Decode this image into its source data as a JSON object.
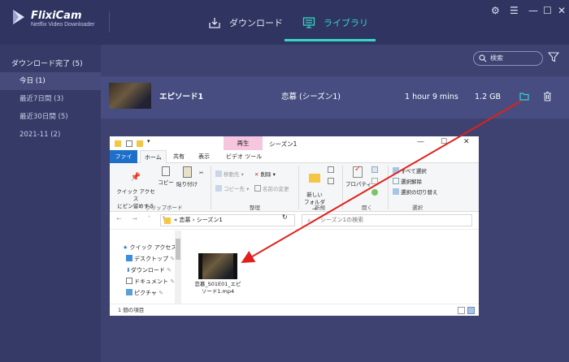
{
  "app": {
    "brand": "FlixiCam",
    "subtitle": "Netflix Video Downloader",
    "tabs": {
      "download": "ダウンロード",
      "library": "ライブラリ"
    }
  },
  "sidebar": {
    "header": "ダウンロード完了 (5)",
    "items": [
      {
        "label": "今日 (1)"
      },
      {
        "label": "最近7日間 (3)"
      },
      {
        "label": "最近30日間 (5)"
      },
      {
        "label": "2021-11 (2)"
      }
    ]
  },
  "toolbar": {
    "search_label": "検索"
  },
  "library_row": {
    "title": "エピソード1",
    "season": "恋慕 (シーズン1)",
    "duration": "1 hour 9 mins",
    "size": "1.2 GB"
  },
  "explorer": {
    "context_tab": "再生",
    "window_title": "シーズン1",
    "ribbon_tabs": {
      "file": "ファイル",
      "home": "ホーム",
      "share": "共有",
      "view": "表示",
      "video_tools": "ビデオ ツール"
    },
    "ribbon": {
      "pin_quick_access": "クイック アクセス\nにピン留めする",
      "copy": "コピー",
      "paste": "貼り付け",
      "move_to": "移動先",
      "copy_to": "コピー先",
      "delete": "削除",
      "rename": "名前の変更",
      "new_folder": "新しい\nフォルダー",
      "properties": "プロパティ",
      "select_all": "すべて選択",
      "select_none": "選択解除",
      "invert_selection": "選択の切り替え",
      "group_clipboard": "クリップボード",
      "group_organize": "整理",
      "group_new": "新規",
      "group_open": "開く",
      "group_select": "選択"
    },
    "address": {
      "path": "« 恋慕 › シーズン1",
      "search_placeholder": "シーズン1の検索"
    },
    "nav": {
      "quick_access": "クイック アクセス",
      "desktop": "デスクトップ",
      "downloads": "ダウンロード",
      "documents": "ドキュメント",
      "pictures": "ピクチャ"
    },
    "file": {
      "name": "恋慕_S01E01_エピソード1.mp4"
    },
    "status": "1 個の項目"
  },
  "colors": {
    "accent": "#36d6c6",
    "arrow": "#e0211b",
    "file_tab": "#1e6fc8",
    "context_tab": "#f5c6de"
  }
}
